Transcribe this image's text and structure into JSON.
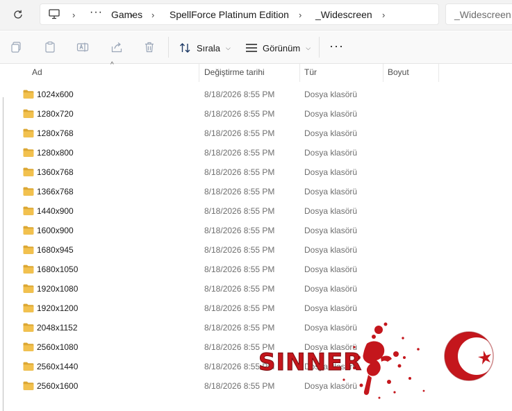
{
  "address": {
    "breadcrumbs": [
      "Games",
      "SpellForce Platinum Edition",
      "_Widescreen"
    ],
    "search_text": "_Widescreen k",
    "icons": {
      "refresh": "refresh-icon",
      "computer": "computer-icon",
      "more": "ellipsis-icon",
      "chevron": "chevron-right-icon"
    }
  },
  "toolbar": {
    "sort_label": "Sırala",
    "view_label": "Görünüm",
    "icons": [
      "copy-icon",
      "paste-icon",
      "rename-icon",
      "share-icon",
      "delete-icon",
      "sort-icon",
      "view-icon",
      "more-icon"
    ]
  },
  "columns": {
    "name": "Ad",
    "date": "Değiştirme tarihi",
    "type": "Tür",
    "size": "Boyut"
  },
  "rows": [
    {
      "name": "1024x600",
      "date": "8/18/2026 8:55 PM",
      "type": "Dosya klasörü"
    },
    {
      "name": "1280x720",
      "date": "8/18/2026 8:55 PM",
      "type": "Dosya klasörü"
    },
    {
      "name": "1280x768",
      "date": "8/18/2026 8:55 PM",
      "type": "Dosya klasörü"
    },
    {
      "name": "1280x800",
      "date": "8/18/2026 8:55 PM",
      "type": "Dosya klasörü"
    },
    {
      "name": "1360x768",
      "date": "8/18/2026 8:55 PM",
      "type": "Dosya klasörü"
    },
    {
      "name": "1366x768",
      "date": "8/18/2026 8:55 PM",
      "type": "Dosya klasörü"
    },
    {
      "name": "1440x900",
      "date": "8/18/2026 8:55 PM",
      "type": "Dosya klasörü"
    },
    {
      "name": "1600x900",
      "date": "8/18/2026 8:55 PM",
      "type": "Dosya klasörü"
    },
    {
      "name": "1680x945",
      "date": "8/18/2026 8:55 PM",
      "type": "Dosya klasörü"
    },
    {
      "name": "1680x1050",
      "date": "8/18/2026 8:55 PM",
      "type": "Dosya klasörü"
    },
    {
      "name": "1920x1080",
      "date": "8/18/2026 8:55 PM",
      "type": "Dosya klasörü"
    },
    {
      "name": "1920x1200",
      "date": "8/18/2026 8:55 PM",
      "type": "Dosya klasörü"
    },
    {
      "name": "2048x1152",
      "date": "8/18/2026 8:55 PM",
      "type": "Dosya klasörü"
    },
    {
      "name": "2560x1080",
      "date": "8/18/2026 8:55 PM",
      "type": "Dosya klasörü"
    },
    {
      "name": "2560x1440",
      "date": "8/18/2026 8:55 PM",
      "type": "Dosya klasörü"
    },
    {
      "name": "2560x1600",
      "date": "8/18/2026 8:55 PM",
      "type": "Dosya klasörü"
    }
  ],
  "watermark": {
    "text": "SINNER",
    "color": "#c4161c"
  },
  "colors": {
    "folder": "#f2c14e",
    "folder_dark": "#dca733",
    "toolbar_bg": "#f9f9f9"
  }
}
